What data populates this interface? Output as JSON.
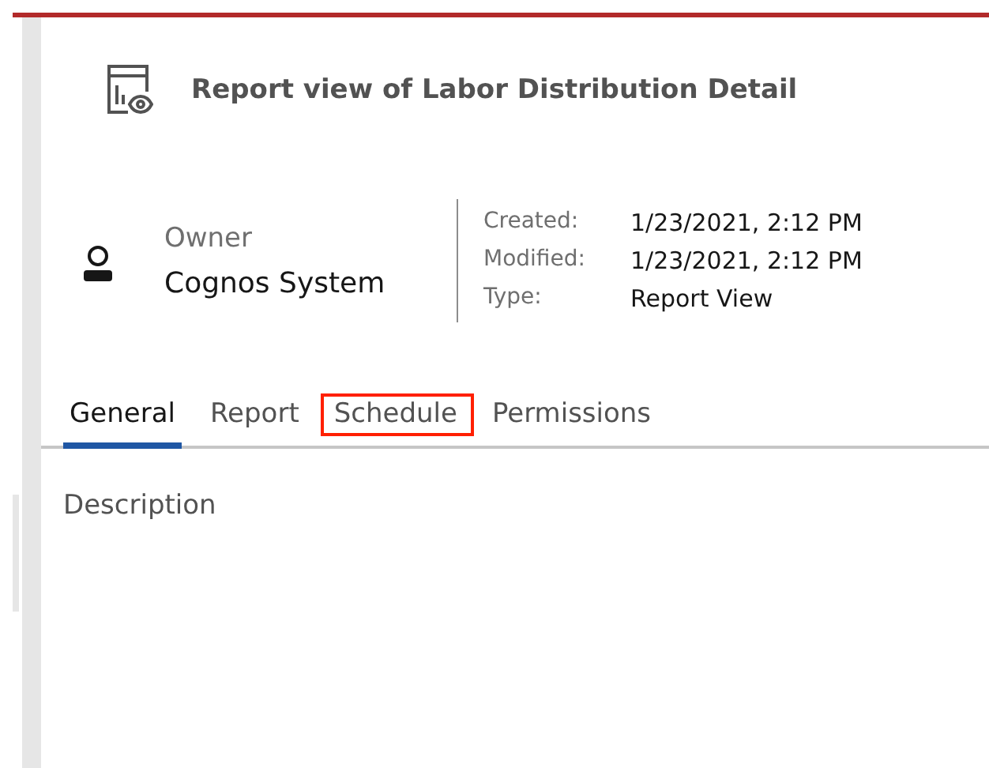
{
  "title": "Report view of Labor Distribution Detail",
  "owner": {
    "label": "Owner",
    "name": "Cognos System"
  },
  "properties": [
    {
      "label": "Created:",
      "value": "1/23/2021, 2:12 PM"
    },
    {
      "label": "Modified:",
      "value": "1/23/2021, 2:12 PM"
    },
    {
      "label": "Type:",
      "value": "Report View"
    }
  ],
  "tabs": [
    {
      "label": "General",
      "selected": true,
      "highlighted": false
    },
    {
      "label": "Report",
      "selected": false,
      "highlighted": false
    },
    {
      "label": "Schedule",
      "selected": false,
      "highlighted": true
    },
    {
      "label": "Permissions",
      "selected": false,
      "highlighted": false
    }
  ],
  "description": {
    "label": "Description"
  }
}
